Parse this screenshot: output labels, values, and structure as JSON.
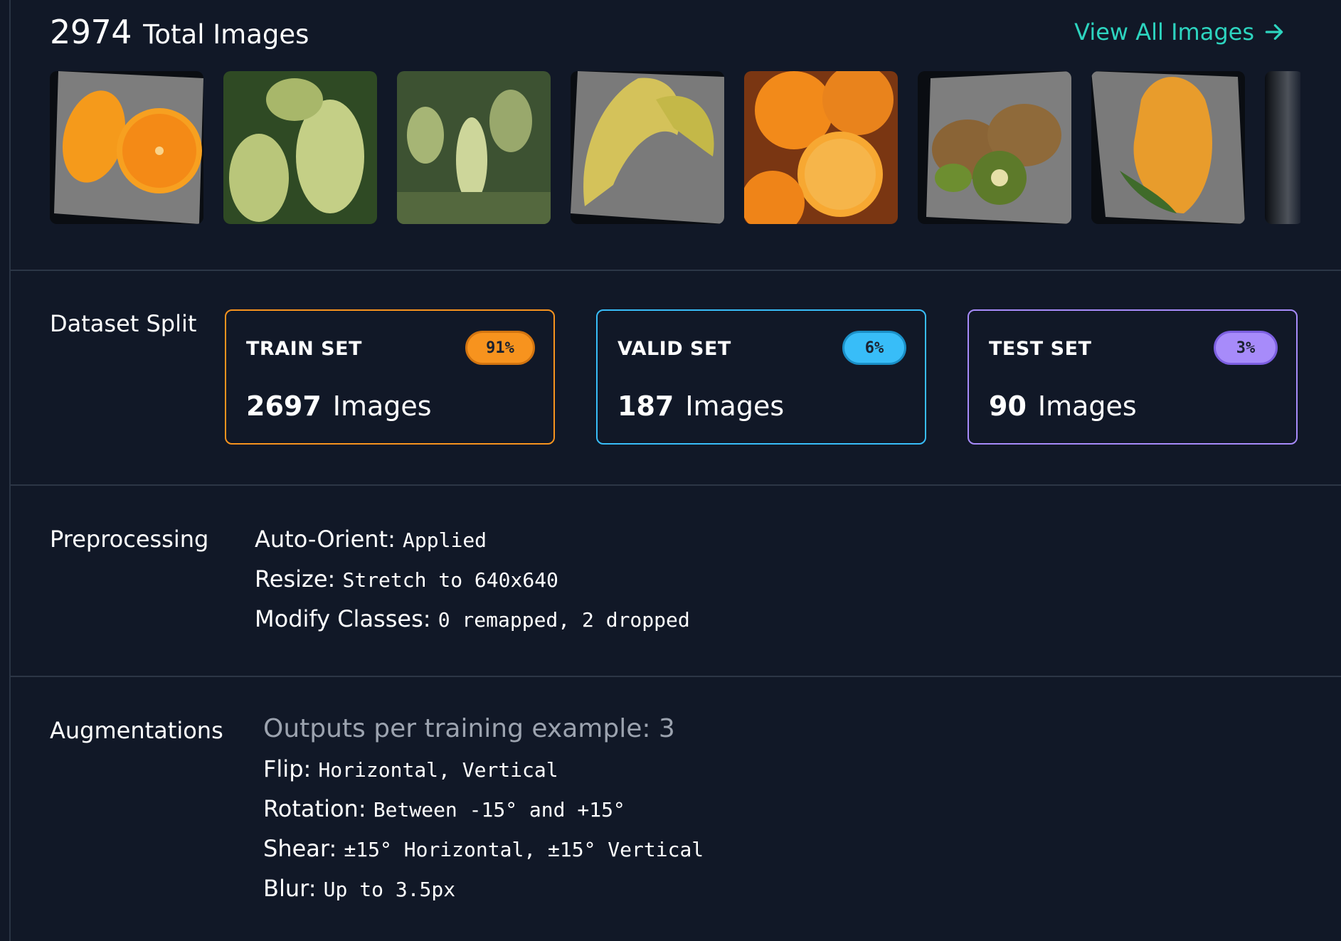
{
  "header": {
    "total_count": "2974",
    "total_label": "Total Images",
    "view_all_label": "View All Images"
  },
  "thumbnails": [
    {
      "subject": "orange"
    },
    {
      "subject": "grapes"
    },
    {
      "subject": "grape-vine"
    },
    {
      "subject": "banana"
    },
    {
      "subject": "orange"
    },
    {
      "subject": "kiwi"
    },
    {
      "subject": "papaya"
    },
    {
      "subject": "partial"
    }
  ],
  "dataset_split": {
    "label": "Dataset Split",
    "train": {
      "title": "TRAIN SET",
      "percent": "91%",
      "count": "2697",
      "unit": "Images",
      "color": "#f7931e"
    },
    "valid": {
      "title": "VALID SET",
      "percent": "6%",
      "count": "187",
      "unit": "Images",
      "color": "#38bdf8"
    },
    "test": {
      "title": "TEST SET",
      "percent": "3%",
      "count": "90",
      "unit": "Images",
      "color": "#a78bfa"
    }
  },
  "preprocessing": {
    "label": "Preprocessing",
    "items": [
      {
        "key": "Auto-Orient:",
        "value": "Applied"
      },
      {
        "key": "Resize:",
        "value": "Stretch to 640x640"
      },
      {
        "key": "Modify Classes:",
        "value": "0 remapped, 2 dropped"
      }
    ]
  },
  "augmentations": {
    "label": "Augmentations",
    "outputs": "Outputs per training example: 3",
    "items": [
      {
        "key": "Flip:",
        "value": "Horizontal, Vertical"
      },
      {
        "key": "Rotation:",
        "value": "Between -15° and +15°"
      },
      {
        "key": "Shear:",
        "value": "±15° Horizontal, ±15° Vertical"
      },
      {
        "key": "Blur:",
        "value": "Up to 3.5px"
      }
    ]
  },
  "colors": {
    "background": "#111827",
    "accent": "#2dd4bf",
    "divider": "#2c3646"
  }
}
